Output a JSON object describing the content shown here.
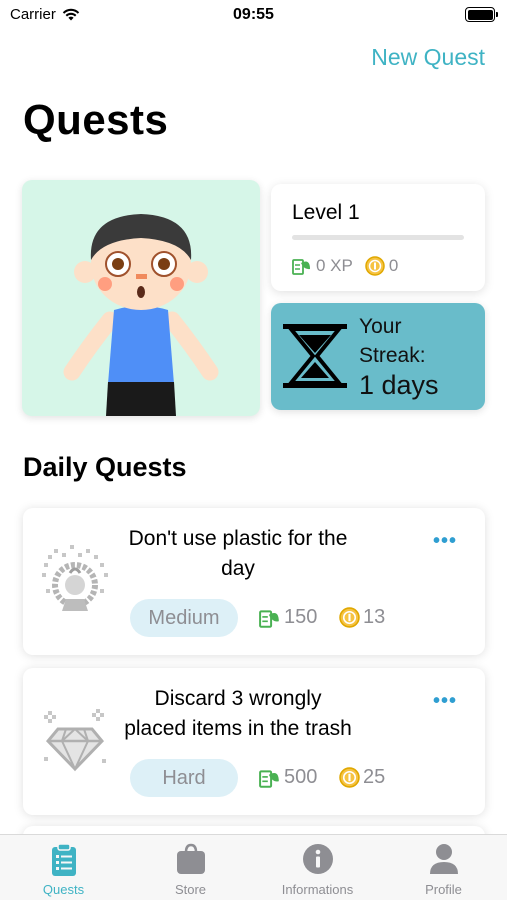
{
  "status_bar": {
    "carrier": "Carrier",
    "time": "09:55"
  },
  "header": {
    "new_quest_label": "New Quest",
    "title": "Quests"
  },
  "level_card": {
    "title": "Level 1",
    "progress": 0,
    "xp": "0 XP",
    "coins": "0"
  },
  "streak_card": {
    "label_line1": "Your",
    "label_line2": "Streak:",
    "value": "1 days"
  },
  "daily": {
    "title": "Daily Quests",
    "quests": [
      {
        "title": "Don't use plastic for the day",
        "difficulty": "Medium",
        "xp": "150",
        "coins": "13",
        "icon": "plastic-fire-icon"
      },
      {
        "title": "Discard 3 wrongly placed items in the trash",
        "difficulty": "Hard",
        "xp": "500",
        "coins": "25",
        "icon": "diamond-icon"
      }
    ]
  },
  "tabs": [
    {
      "label": "Quests",
      "icon": "clipboard-icon",
      "active": true
    },
    {
      "label": "Store",
      "icon": "shopping-bag-icon",
      "active": false
    },
    {
      "label": "Informations",
      "icon": "info-icon",
      "active": false
    },
    {
      "label": "Profile",
      "icon": "person-icon",
      "active": false
    }
  ],
  "colors": {
    "accent": "#3fb3c4",
    "streak_bg": "#69bcca",
    "avatar_bg": "#d6f6e8",
    "chip_bg": "#ddf0f7"
  }
}
